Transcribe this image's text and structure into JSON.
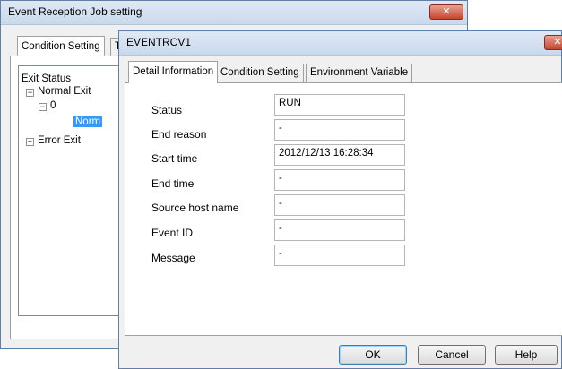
{
  "back_window": {
    "title": "Event Reception Job setting",
    "close_label": "✕",
    "tabs": [
      {
        "label": "Condition Setting"
      },
      {
        "label": "T"
      }
    ],
    "tree": {
      "root": "Exit Status",
      "normal_exit": "Normal Exit",
      "zero": "0",
      "selected_child": "Norm",
      "error_exit": "Error Exit"
    }
  },
  "dialog": {
    "title": "EVENTRCV1",
    "close_label": "✕",
    "tabs": [
      {
        "label": "Detail Information"
      },
      {
        "label": "Condition Setting"
      },
      {
        "label": "Environment Variable"
      }
    ],
    "fields": [
      {
        "label": "Status",
        "value": "RUN"
      },
      {
        "label": "End reason",
        "value": "-"
      },
      {
        "label": "Start time",
        "value": "2012/12/13 16:28:34"
      },
      {
        "label": "End time",
        "value": "-"
      },
      {
        "label": "Source host name",
        "value": "-"
      },
      {
        "label": "Event ID",
        "value": "-"
      },
      {
        "label": "Message",
        "value": "-"
      }
    ],
    "buttons": {
      "ok": "OK",
      "cancel": "Cancel",
      "help": "Help"
    }
  }
}
